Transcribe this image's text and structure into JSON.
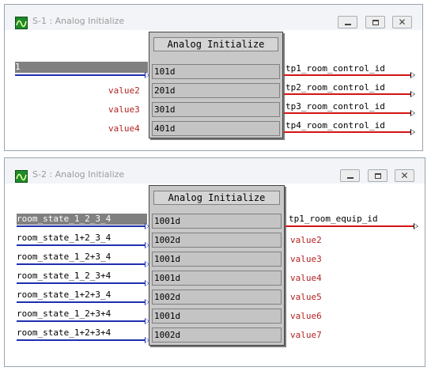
{
  "window1": {
    "title": "S-1 : Analog Initialize",
    "block_title": "Analog Initialize",
    "inputs": [
      "1",
      "value2",
      "value3",
      "value4"
    ],
    "params": [
      "101d",
      "201d",
      "301d",
      "401d"
    ],
    "outputs": [
      "tp1_room_control_id",
      "tp2_room_control_id",
      "tp3_room_control_id",
      "tp4_room_control_id"
    ]
  },
  "window2": {
    "title": "S-2 : Analog Initialize",
    "block_title": "Analog Initialize",
    "inputs": [
      "room_state_1_2_3_4",
      "room_state_1+2_3_4",
      "room_state_1_2+3_4",
      "room_state_1_2_3+4",
      "room_state_1+2+3_4",
      "room_state_1_2+3+4",
      "room_state_1+2+3+4"
    ],
    "params": [
      "1001d",
      "1002d",
      "1001d",
      "1001d",
      "1002d",
      "1001d",
      "1002d"
    ],
    "output": "tp1_room_equip_id",
    "unused_outputs": [
      "value2",
      "value3",
      "value4",
      "value5",
      "value6",
      "value7"
    ]
  },
  "window_buttons": {
    "minimize": "minimize",
    "maximize": "maximize",
    "close": "✕"
  },
  "colors": {
    "input_line": "#1f2fb0",
    "output_line": "#d41414",
    "unused_text": "#b22222",
    "block": "#c8c8c8"
  }
}
